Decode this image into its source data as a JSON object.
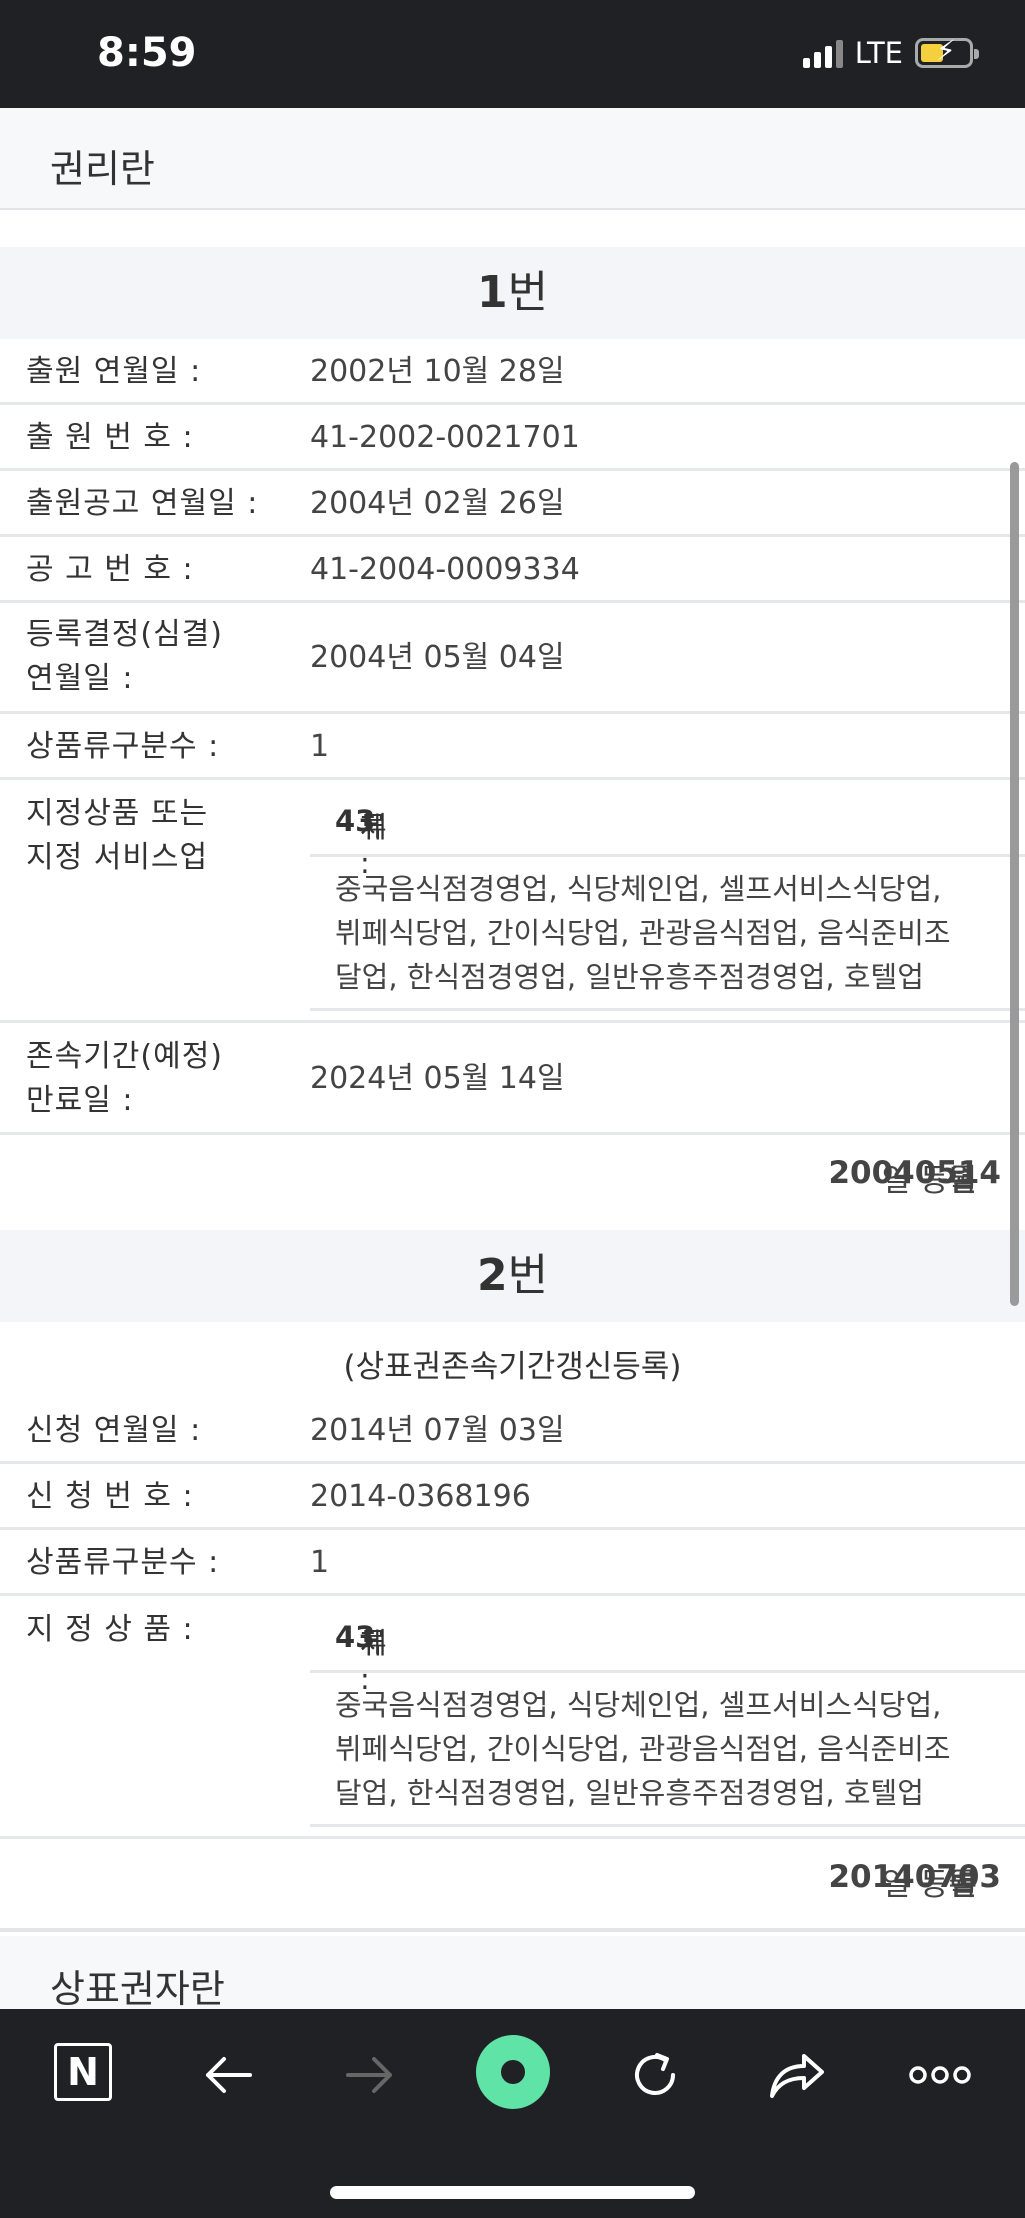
{
  "status_bar": {
    "time": "8:59",
    "network": "LTE"
  },
  "rights_section": {
    "title": "권리란"
  },
  "entry1": {
    "number_digit": "1",
    "number_suffix": "번",
    "rows": [
      {
        "label": "출원 연월일 :",
        "value": "2002년 10월 28일"
      },
      {
        "label": "출 원 번 호 :",
        "value": "41-2002-0021701"
      },
      {
        "label": "출원공고 연월일 :",
        "value": "2004년 02월 26일"
      },
      {
        "label": "공 고 번 호 :",
        "value": "41-2004-0009334"
      },
      {
        "label_line1": "등록결정(심결)",
        "label_line2": "연월일 :",
        "value": "2004년 05월 04일"
      },
      {
        "label": "상품류구분수 :",
        "value": "1"
      }
    ],
    "goods": {
      "label_line1": "지정상품 또는",
      "label_line2": "지정 서비스업",
      "class_prefix": "제",
      "class_number": "43",
      "class_suffix": "류 :",
      "lines": [
        "중국음식점경영업, 식당체인업, 셀프서비스식당업,",
        "뷔페식당업, 간이식당업, 관광음식점업, 음식준비조",
        "달업, 한식점경영업, 일반유흥주점경영업, 호텔업"
      ]
    },
    "expiry": {
      "label_line1": "존속기간(예정)",
      "label_line2": "만료일 :",
      "value": "2024년 05월 14일"
    },
    "registered": {
      "year": "2004",
      "year_unit": "년 ",
      "month": "05",
      "month_unit": "월 ",
      "day": "14",
      "day_unit": "일 등록"
    }
  },
  "entry2": {
    "number_digit": "2",
    "number_suffix": "번",
    "subtitle": "(상표권존속기간갱신등록)",
    "rows": [
      {
        "label": "신청 연월일 :",
        "value": "2014년 07월 03일"
      },
      {
        "label": "신 청 번 호 :",
        "value": "2014-0368196"
      },
      {
        "label": "상품류구분수 :",
        "value": "1"
      }
    ],
    "goods": {
      "label": "지 정 상 품 :",
      "class_prefix": "제",
      "class_number": "43",
      "class_suffix": "류 :",
      "lines": [
        "중국음식점경영업, 식당체인업, 셀프서비스식당업,",
        "뷔페식당업, 간이식당업, 관광음식점업, 음식준비조",
        "달업, 한식점경영업, 일반유흥주점경영업, 호텔업"
      ]
    },
    "registered": {
      "year": "2014",
      "year_unit": "년 ",
      "month": "07",
      "month_unit": "월 ",
      "day": "03",
      "day_unit": "일 등록"
    }
  },
  "owner_section": {
    "title": "상표권자란"
  },
  "toolbar": {
    "logo_letter": "N",
    "icons": [
      "naver-logo-icon",
      "back-arrow-icon",
      "forward-arrow-icon",
      "home-green-icon",
      "refresh-icon",
      "share-icon",
      "more-icon"
    ]
  },
  "colors": {
    "toolbar_bg": "#202124",
    "home_button": "#5fe3a6",
    "header_bg": "#f4f5f8"
  }
}
